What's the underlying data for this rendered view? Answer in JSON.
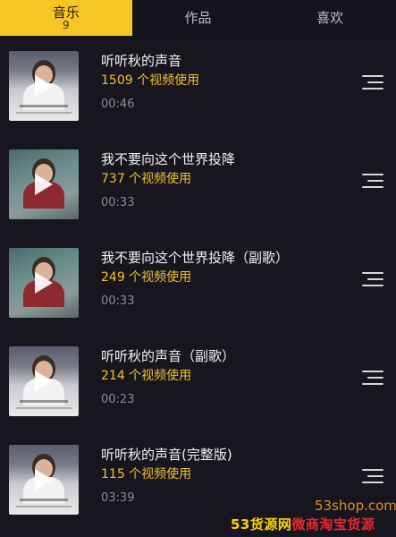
{
  "tabs": [
    {
      "label": "音乐",
      "count": "9",
      "active": true
    },
    {
      "label": "作品",
      "active": false
    },
    {
      "label": "喜欢",
      "active": false
    }
  ],
  "songs": [
    {
      "title": "听听秋的声音",
      "uses": "1509 个视频使用",
      "duration": "00:46",
      "cover": "cover-a"
    },
    {
      "title": "我不要向这个世界投降",
      "uses": "737 个视频使用",
      "duration": "00:33",
      "cover": "cover-b"
    },
    {
      "title": "我不要向这个世界投降（副歌）",
      "uses": "249 个视频使用",
      "duration": "00:33",
      "cover": "cover-b"
    },
    {
      "title": "听听秋的声音（副歌）",
      "uses": "214 个视频使用",
      "duration": "00:23",
      "cover": "cover-a"
    },
    {
      "title": "听听秋的声音(完整版)",
      "uses": "115 个视频使用",
      "duration": "03:39",
      "cover": "cover-a"
    }
  ],
  "watermark": {
    "site": "53shop.com",
    "banner_prefix": "53货源网",
    "banner_suffix": "微商淘宝货源"
  },
  "colors": {
    "accent": "#f8c624",
    "uses_text": "#f2c12e",
    "background": "#17161f"
  },
  "icons": {
    "play": "play-icon",
    "more": "menu-lines-icon"
  }
}
